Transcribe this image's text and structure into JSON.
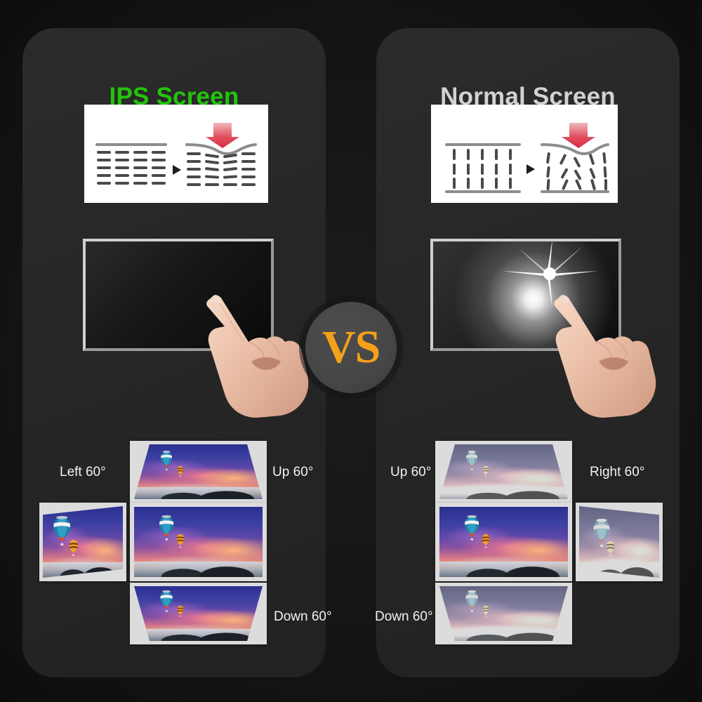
{
  "page": {
    "background_color": "#161616",
    "panel_color": "#262626"
  },
  "comparison": {
    "vs_label": "VS",
    "vs_color": "#f5a11a"
  },
  "panels": [
    {
      "id": "ips",
      "title": "IPS Screen",
      "title_color": "#22c40a",
      "structure_diagram": {
        "name": "horizontal-alignment-diagram",
        "description": "Horizontally aligned liquid crystal layers deform slightly under pressure",
        "arrow_color": "#e0455c"
      },
      "touch_demo": {
        "name": "no-ripple-screen",
        "description": "Screen stays black with no bright pressure bloom when touched"
      },
      "angles": [
        {
          "position": "left",
          "label": "Left 60°",
          "faded": false
        },
        {
          "position": "up",
          "label": "Up 60°",
          "faded": false
        },
        {
          "position": "center",
          "label": "",
          "faded": false
        },
        {
          "position": "down",
          "label": "Down 60°",
          "faded": false
        }
      ]
    },
    {
      "id": "normal",
      "title": "Normal Screen",
      "title_color": "#d2d2d2",
      "structure_diagram": {
        "name": "vertical-alignment-diagram",
        "description": "Vertically aligned liquid crystal layers scatter badly under pressure",
        "arrow_color": "#e0455c"
      },
      "touch_demo": {
        "name": "ripple-glow-screen",
        "description": "Bright white starburst bloom appears where the screen is touched"
      },
      "angles": [
        {
          "position": "up",
          "label": "Up 60°",
          "faded": true
        },
        {
          "position": "right",
          "label": "Right 60°",
          "faded": true
        },
        {
          "position": "center",
          "label": "",
          "faded": false
        },
        {
          "position": "down",
          "label": "Down 60°",
          "faded": true
        }
      ]
    }
  ],
  "image_subject": "hot air balloons at sunset"
}
